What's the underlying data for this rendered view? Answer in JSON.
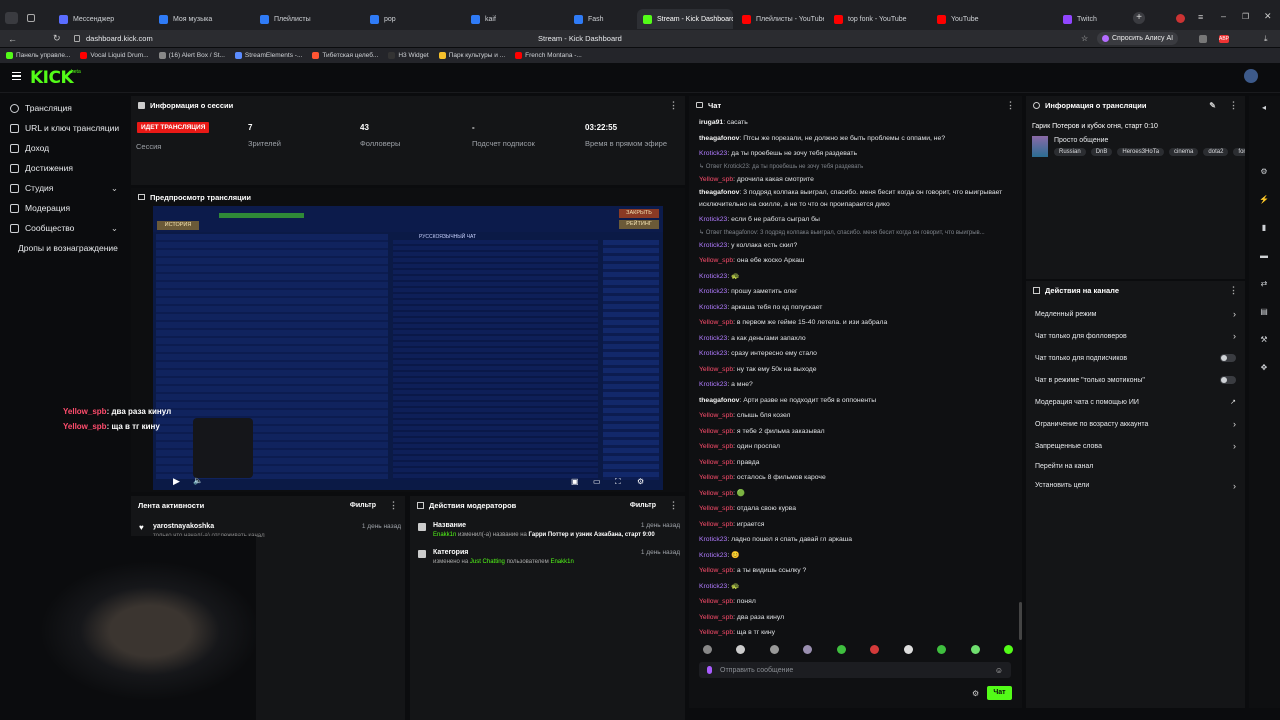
{
  "tabs": [
    {
      "label": "Мессенджер",
      "color": "#5a6cff"
    },
    {
      "label": "Моя музыка",
      "color": "#2f7bf6"
    },
    {
      "label": "Плейлисты",
      "color": "#2f7bf6"
    },
    {
      "label": "pop",
      "color": "#2f7bf6"
    },
    {
      "label": "kaif",
      "color": "#2f7bf6"
    },
    {
      "label": "Fash",
      "color": "#2f7bf6"
    },
    {
      "label": "Stream - Kick Dashboard",
      "color": "#53fc18"
    },
    {
      "label": "Плейлисты - YouTube",
      "color": "#ff0000"
    },
    {
      "label": "top fonk - YouTube",
      "color": "#ff0000"
    },
    {
      "label": "YouTube",
      "color": "#ff0000"
    },
    {
      "label": "Twitch",
      "color": "#9146ff"
    }
  ],
  "address": {
    "url": "dashboard.kick.com",
    "page_title": "Stream - Kick Dashboard",
    "alice_label": "Спросить Алису AI"
  },
  "bookmarks": [
    "Панель управле...",
    "Vocal Liquid Drum...",
    "(16) Alert Box / St...",
    "StreamElements -...",
    "Тибетская целеб...",
    "H3 Widget",
    "Парк культуры и ...",
    "French Montana -..."
  ],
  "kick": {
    "logo": "KICK",
    "beta": "beta"
  },
  "sidebar": {
    "items": [
      {
        "label": "Трансляция",
        "icon": "broadcast-icon"
      },
      {
        "label": "URL и ключ трансляции",
        "icon": "key-icon"
      },
      {
        "label": "Доход",
        "icon": "money-icon"
      },
      {
        "label": "Достижения",
        "icon": "trophy-icon"
      },
      {
        "label": "Студия",
        "icon": "studio-icon"
      },
      {
        "label": "Модерация",
        "icon": "shield-icon"
      },
      {
        "label": "Сообщество",
        "icon": "community-icon"
      },
      {
        "label": "Дропы и вознаграждение",
        "icon": ""
      }
    ]
  },
  "session": {
    "title": "Информация о сессии",
    "live_badge": "ИДЕТ ТРАНСЛЯЦИЯ",
    "session_label": "Сессия",
    "stats": [
      {
        "value": "7",
        "label": "Зрителей"
      },
      {
        "value": "43",
        "label": "Фолловеры"
      },
      {
        "value": "-",
        "label": "Подсчет подписок"
      },
      {
        "value": "03:22:55",
        "label": "Время в прямом эфире"
      }
    ]
  },
  "preview": {
    "title": "Предпросмотр трансляции",
    "overlay": [
      {
        "user": "Yellow_spb",
        "text": "два раза кинул"
      },
      {
        "user": "Yellow_spb",
        "text": "ща в тг кину"
      }
    ],
    "game_buttons": [
      "ИСТОРИЯ",
      "ЗАКРЫТЬ",
      "РЕЙТИНГ"
    ],
    "game_title": "РУССКОЯЗЫЧНЫЙ ЧАТ"
  },
  "activity": {
    "title": "Лента активности",
    "filter": "Фильтр",
    "items": [
      {
        "user": "yarostnayakoshka",
        "text": "только что начал(-а) отслеживать канал",
        "time": "1 день назад"
      }
    ]
  },
  "modactions": {
    "title": "Действия модераторов",
    "filter": "Фильтр",
    "items": [
      {
        "title": "Название",
        "actor": "Enakk1n",
        "text": "изменил(-а) название на",
        "target": "Гарри Поттер и узник Азкабана, старт 9:00",
        "time": "1 день назад"
      },
      {
        "title": "Категория",
        "pre": "изменено на",
        "target": "Just Chatting",
        "mid": "пользователем",
        "actor": "Enakk1n",
        "time": "1 день назад"
      }
    ]
  },
  "chat": {
    "title": "Чат",
    "messages": [
      {
        "u": "iruga91",
        "c": "white",
        "t": "сасать"
      },
      {
        "u": "theagafonov",
        "c": "white",
        "t": "Птсы же порезали, не должно же быть проблемы с оппами, не?"
      },
      {
        "u": "Krotick23",
        "c": "purple",
        "t": "да ты проебешь не зочу тебя раздевать"
      },
      {
        "reply": "Ответ Krotick23: да ты проебешь не зочу тебя раздевать"
      },
      {
        "u": "Yellow_spb",
        "c": "red",
        "t": "дрочила какая смотрите"
      },
      {
        "u": "theagafonov",
        "c": "white",
        "t": "3 подряд колпака выиграл, спасибо. меня бесит когда он говорит, что выигрывает исключительно на скилле, а не то что он проипарается дико",
        "two": true
      },
      {
        "u": "Krotick23",
        "c": "purple",
        "t": "если б не работа сыграл бы"
      },
      {
        "reply": "Ответ theagafonov: 3 подряд колпака выиграл, спасибо. меня бесит когда он говорит, что выигрыв..."
      },
      {
        "u": "Krotick23",
        "c": "purple",
        "t": "у коллака есть скил?"
      },
      {
        "u": "Yellow_spb",
        "c": "red",
        "t": "она ебе жоско Аркаш"
      },
      {
        "u": "Krotick23",
        "c": "purple",
        "t": "🐢"
      },
      {
        "u": "Krotick23",
        "c": "purple",
        "t": "прошу заметить олег"
      },
      {
        "u": "Krotick23",
        "c": "purple",
        "t": "аркаша тебя по кд попускает"
      },
      {
        "u": "Yellow_spb",
        "c": "red",
        "t": "в первом же гейме 15-40 летела. и изи забрала"
      },
      {
        "u": "Krotick23",
        "c": "purple",
        "t": "а как деньгами запахло"
      },
      {
        "u": "Krotick23",
        "c": "purple",
        "t": "сразу интересно ему стало"
      },
      {
        "u": "Yellow_spb",
        "c": "red",
        "t": "ну так ему 50к на выходе"
      },
      {
        "u": "Krotick23",
        "c": "purple",
        "t": "а мне?"
      },
      {
        "u": "theagafonov",
        "c": "white",
        "t": "Арти разве не подходит тебя в оппоненты"
      },
      {
        "u": "Yellow_spb",
        "c": "red",
        "t": "слышь бля козел"
      },
      {
        "u": "Yellow_spb",
        "c": "red",
        "t": "я тебе 2 фильма заказывал"
      },
      {
        "u": "Yellow_spb",
        "c": "red",
        "t": "один проспал"
      },
      {
        "u": "Yellow_spb",
        "c": "red",
        "t": "правда"
      },
      {
        "u": "Yellow_spb",
        "c": "red",
        "t": "осталось 8 фильмов кароче"
      },
      {
        "u": "Yellow_spb",
        "c": "red",
        "t": "🟢"
      },
      {
        "u": "Yellow_spb",
        "c": "red",
        "t": "отдала свою курва"
      },
      {
        "u": "Yellow_spb",
        "c": "red",
        "t": "играется"
      },
      {
        "u": "Krotick23",
        "c": "purple",
        "t": "ладно пошел я спать давай гл аркаша"
      },
      {
        "u": "Krotick23",
        "c": "purple",
        "t": "😊"
      },
      {
        "u": "Yellow_spb",
        "c": "red",
        "t": "а ты видишь ссылку ?"
      },
      {
        "u": "Krotick23",
        "c": "purple",
        "t": "🐢"
      },
      {
        "u": "Yellow_spb",
        "c": "red",
        "t": "понял"
      },
      {
        "u": "Yellow_spb",
        "c": "red",
        "t": "два раза кинул"
      },
      {
        "u": "Yellow_spb",
        "c": "red",
        "t": "ща в тг кину"
      }
    ],
    "input_placeholder": "Отправить сообщение",
    "send_label": "Чат"
  },
  "stream_info": {
    "title": "Информация о трансляции",
    "stream_title": "Гарик Потеров и кубок огня, старт 0:10",
    "category": "Просто общение",
    "tags": [
      "Russian",
      "DnB",
      "Heroes3HoTa",
      "cinema",
      "dota2",
      "fonk"
    ]
  },
  "channel_actions": {
    "title": "Действия на канале",
    "items": [
      {
        "label": "Медленный режим",
        "kind": "chev"
      },
      {
        "label": "Чат только для фолловеров",
        "kind": "chev"
      },
      {
        "label": "Чат только для подписчиков",
        "kind": "toggle"
      },
      {
        "label": "Чат в режиме \"только эмотиконы\"",
        "kind": "toggle"
      },
      {
        "label": "Модерация чата с помощью ИИ",
        "kind": "ext"
      },
      {
        "label": "Ограничение по возрасту аккаунта",
        "kind": "chev"
      },
      {
        "label": "Запрещенные слова",
        "kind": "chev"
      },
      {
        "label": "Перейти на канал",
        "kind": "none"
      },
      {
        "label": "Установить цели",
        "kind": "chev"
      }
    ]
  },
  "colors": {
    "kick_green": "#53fc18",
    "live_red": "#e91916",
    "purple_user": "#b17bff",
    "red_user": "#ff4d6d"
  }
}
